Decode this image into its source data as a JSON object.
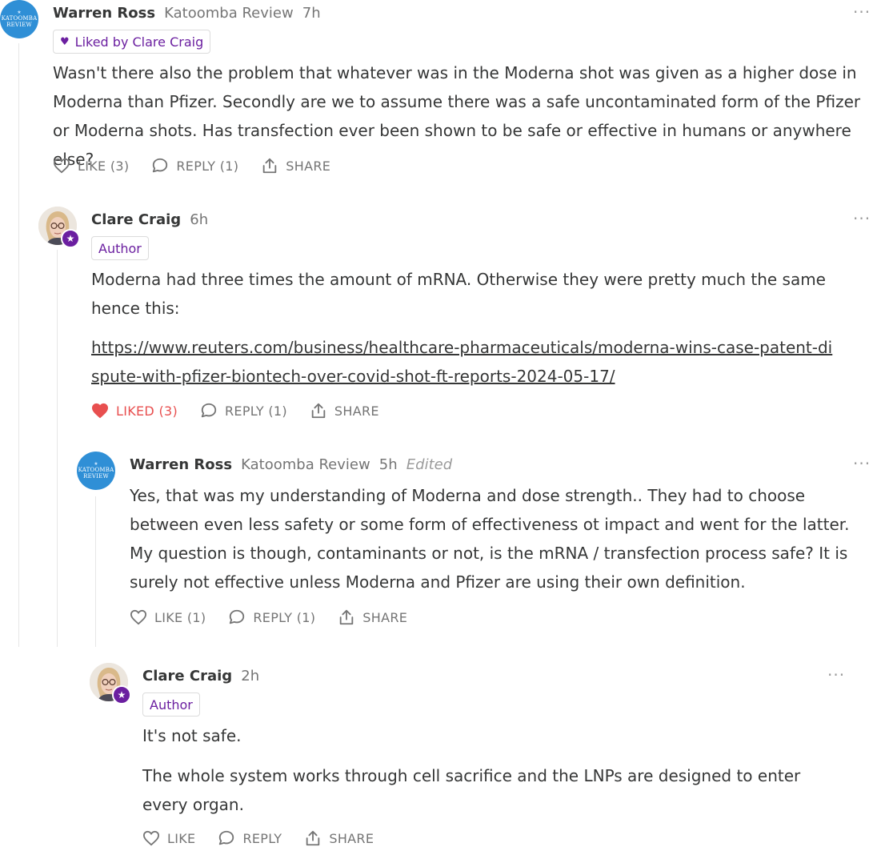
{
  "comments": [
    {
      "author": "Warren Ross",
      "publication": "Katoomba Review",
      "time": "7h",
      "badge": "Liked by Clare Craig",
      "logo_lines": [
        "KATOOMBA",
        "REVIEW"
      ],
      "paragraphs": [
        "Wasn't there also the problem that whatever was in the Moderna shot was given as a higher dose in Moderna than Pfizer. Secondly are we to assume there was a safe uncontaminated  form of the Pfizer or Moderna shots. Has transfection ever been shown to be safe or effective in humans or anywhere else?"
      ],
      "actions": {
        "like": "LIKE (3)",
        "reply": "REPLY (1)",
        "share": "SHARE"
      }
    },
    {
      "author": "Clare Craig",
      "time": "6h",
      "badge": "Author",
      "paragraphs": [
        "Moderna had three times the amount of mRNA. Otherwise they were pretty much the same hence this:"
      ],
      "link": "https://www.reuters.com/business/healthcare-pharmaceuticals/moderna-wins-case-patent-dispute-with-pfizer-biontech-over-covid-shot-ft-reports-2024-05-17/",
      "actions": {
        "like": "LIKED (3)",
        "reply": "REPLY (1)",
        "share": "SHARE"
      }
    },
    {
      "author": "Warren Ross",
      "publication": "Katoomba Review",
      "time": "5h",
      "edited": "Edited",
      "logo_lines": [
        "KATOOMBA",
        "REVIEW"
      ],
      "paragraphs": [
        "Yes, that was my understanding of Moderna and dose strength.. They had to choose between even less safety or some form of effectiveness ot impact and went for the latter. My question is though, contaminants or not, is the mRNA / transfection process safe? It is surely not effective unless Moderna and Pfizer are using their own definition."
      ],
      "actions": {
        "like": "LIKE (1)",
        "reply": "REPLY (1)",
        "share": "SHARE"
      }
    },
    {
      "author": "Clare Craig",
      "time": "2h",
      "badge": "Author",
      "paragraphs": [
        "It's not safe.",
        "The whole system works through cell sacrifice and the LNPs are designed to enter every organ."
      ],
      "actions": {
        "like": "LIKE",
        "reply": "REPLY",
        "share": "SHARE"
      }
    }
  ],
  "more_glyph": "···",
  "colors": {
    "purple": "#6b1fa0",
    "liked_red": "#e84f4f",
    "muted": "#757575",
    "text": "#363737",
    "logo_blue": "#2f8fd6"
  }
}
